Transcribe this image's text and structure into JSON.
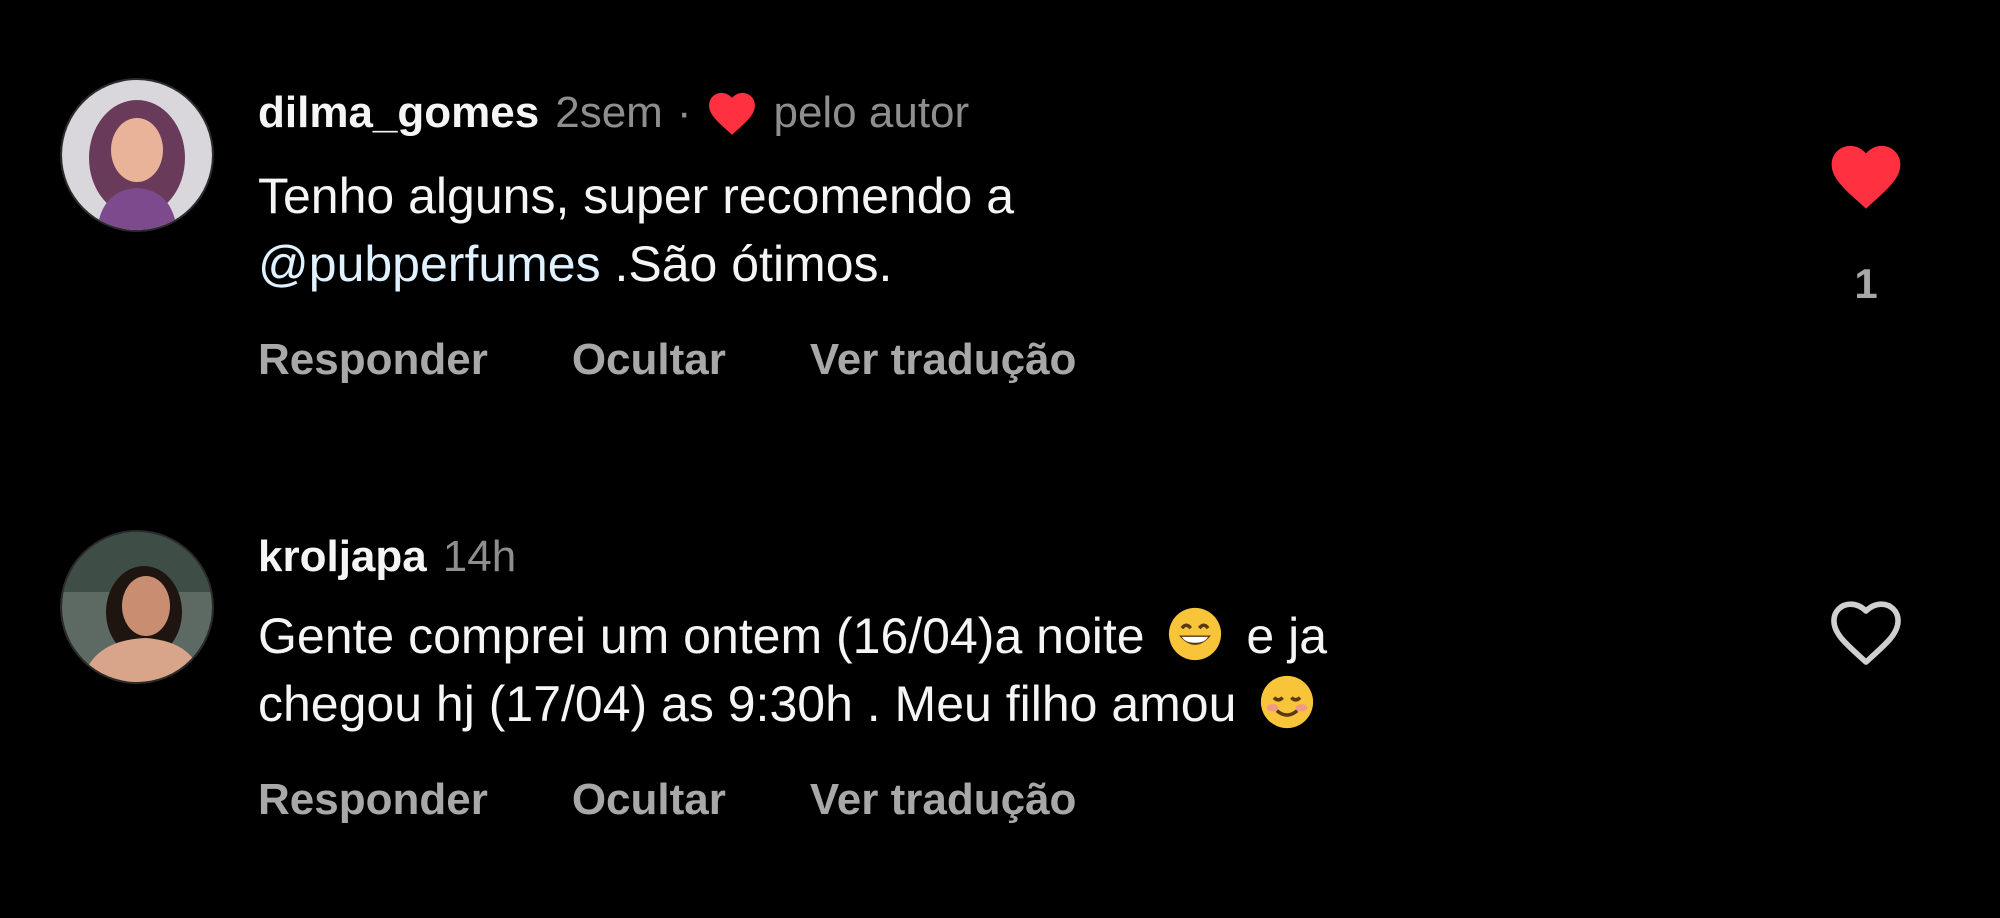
{
  "colors": {
    "background": "#000000",
    "text_primary": "#f5f5f5",
    "text_secondary": "#8e8e8e",
    "action_text": "#a8a8a8",
    "like_red": "#ff3040"
  },
  "comments": [
    {
      "username": "dilma_gomes",
      "time": "2sem",
      "separator": "·",
      "liked_by_author_icon": "heart-filled-icon",
      "liked_by_author_label": "pelo autor",
      "text_lines": [
        "Tenho alguns, super recomendo a",
        "@pubperfumes .São ótimos."
      ],
      "mention": "@pubperfumes",
      "text_line2_rest": " .São ótimos.",
      "actions": {
        "reply": "Responder",
        "hide": "Ocultar",
        "translate": "Ver tradução"
      },
      "like_icon": "heart-filled-icon",
      "liked": true,
      "like_count": "1"
    },
    {
      "username": "kroljapa",
      "time": "14h",
      "text_part1": "Gente comprei um ontem (16/04)a noite",
      "emoji1": "grinning-face-emoji",
      "text_part2": "e ja",
      "text_line2": "chegou hj (17/04) as 9:30h . Meu filho amou",
      "emoji2": "smiling-face-emoji",
      "actions": {
        "reply": "Responder",
        "hide": "Ocultar",
        "translate": "Ver tradução"
      },
      "like_icon": "heart-outline-icon",
      "liked": false
    }
  ]
}
